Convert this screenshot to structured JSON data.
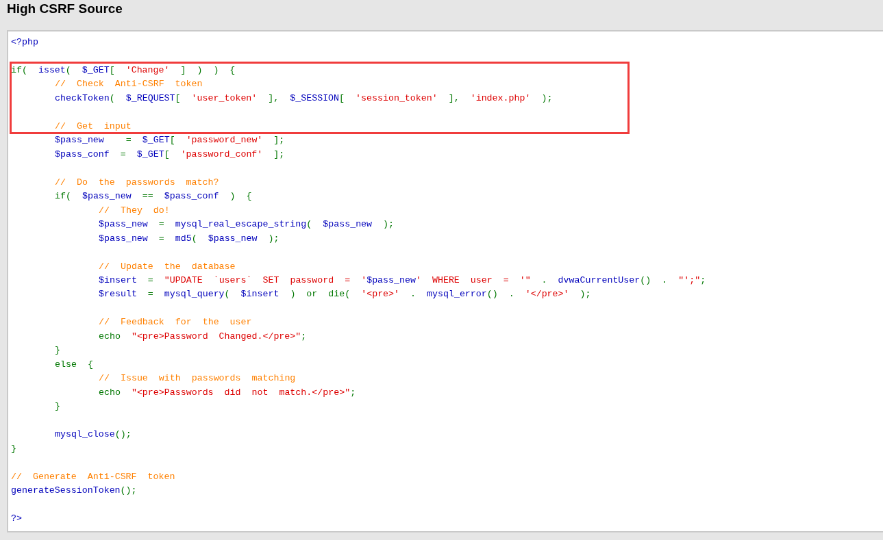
{
  "title": "High CSRF Source",
  "blocks": [
    {
      "highlighted": false,
      "lines": [
        {
          "kind": "code",
          "tokens": [
            {
              "kind": "default",
              "text": "<?php"
            }
          ]
        },
        {
          "kind": "blank"
        }
      ]
    },
    {
      "highlighted": true,
      "lines": [
        {
          "kind": "code",
          "tokens": [
            {
              "kind": "keyword",
              "text": "if( "
            },
            {
              "kind": "default",
              "text": "isset"
            },
            {
              "kind": "keyword",
              "text": "( "
            },
            {
              "kind": "default",
              "text": "$_GET"
            },
            {
              "kind": "keyword",
              "text": "[ "
            },
            {
              "kind": "string",
              "text": "'Change'"
            },
            {
              "kind": "keyword",
              "text": " ] ) ) {"
            }
          ]
        },
        {
          "kind": "code",
          "tokens": [
            {
              "kind": "comment",
              "text": "\t// Check Anti-CSRF token"
            }
          ]
        },
        {
          "kind": "code",
          "tokens": [
            {
              "kind": "default",
              "text": "\tcheckToken"
            },
            {
              "kind": "keyword",
              "text": "( "
            },
            {
              "kind": "default",
              "text": "$_REQUEST"
            },
            {
              "kind": "keyword",
              "text": "[ "
            },
            {
              "kind": "string",
              "text": "'user_token'"
            },
            {
              "kind": "keyword",
              "text": " ], "
            },
            {
              "kind": "default",
              "text": "$_SESSION"
            },
            {
              "kind": "keyword",
              "text": "[ "
            },
            {
              "kind": "string",
              "text": "'session_token'"
            },
            {
              "kind": "keyword",
              "text": " ], "
            },
            {
              "kind": "string",
              "text": "'index.php'"
            },
            {
              "kind": "keyword",
              "text": " );"
            }
          ]
        },
        {
          "kind": "blank"
        },
        {
          "kind": "code",
          "tokens": [
            {
              "kind": "comment",
              "text": "\t// Get input"
            }
          ]
        }
      ]
    },
    {
      "highlighted": false,
      "lines": [
        {
          "kind": "code",
          "tokens": [
            {
              "kind": "default",
              "text": "\t$pass_new "
            },
            {
              "kind": "keyword",
              "text": " = "
            },
            {
              "kind": "default",
              "text": "$_GET"
            },
            {
              "kind": "keyword",
              "text": "[ "
            },
            {
              "kind": "string",
              "text": "'password_new'"
            },
            {
              "kind": "keyword",
              "text": " ];"
            }
          ]
        },
        {
          "kind": "code",
          "tokens": [
            {
              "kind": "default",
              "text": "\t$pass_conf"
            },
            {
              "kind": "keyword",
              "text": " = "
            },
            {
              "kind": "default",
              "text": "$_GET"
            },
            {
              "kind": "keyword",
              "text": "[ "
            },
            {
              "kind": "string",
              "text": "'password_conf'"
            },
            {
              "kind": "keyword",
              "text": " ];"
            }
          ]
        },
        {
          "kind": "blank"
        },
        {
          "kind": "code",
          "tokens": [
            {
              "kind": "comment",
              "text": "\t// Do the passwords match?"
            }
          ]
        },
        {
          "kind": "code",
          "tokens": [
            {
              "kind": "keyword",
              "text": "\tif( "
            },
            {
              "kind": "default",
              "text": "$pass_new"
            },
            {
              "kind": "keyword",
              "text": " == "
            },
            {
              "kind": "default",
              "text": "$pass_conf"
            },
            {
              "kind": "keyword",
              "text": " ) {"
            }
          ]
        },
        {
          "kind": "code",
          "tokens": [
            {
              "kind": "comment",
              "text": "\t\t// They do!"
            }
          ]
        },
        {
          "kind": "code",
          "tokens": [
            {
              "kind": "default",
              "text": "\t\t$pass_new"
            },
            {
              "kind": "keyword",
              "text": " = "
            },
            {
              "kind": "default",
              "text": "mysql_real_escape_string"
            },
            {
              "kind": "keyword",
              "text": "( "
            },
            {
              "kind": "default",
              "text": "$pass_new"
            },
            {
              "kind": "keyword",
              "text": " );"
            }
          ]
        },
        {
          "kind": "code",
          "tokens": [
            {
              "kind": "default",
              "text": "\t\t$pass_new"
            },
            {
              "kind": "keyword",
              "text": " = "
            },
            {
              "kind": "default",
              "text": "md5"
            },
            {
              "kind": "keyword",
              "text": "( "
            },
            {
              "kind": "default",
              "text": "$pass_new"
            },
            {
              "kind": "keyword",
              "text": " );"
            }
          ]
        },
        {
          "kind": "blank"
        },
        {
          "kind": "code",
          "tokens": [
            {
              "kind": "comment",
              "text": "\t\t// Update the database"
            }
          ]
        },
        {
          "kind": "code",
          "tokens": [
            {
              "kind": "default",
              "text": "\t\t$insert"
            },
            {
              "kind": "keyword",
              "text": " = "
            },
            {
              "kind": "string",
              "text": "\"UPDATE `users` SET password = '"
            },
            {
              "kind": "default",
              "text": "$pass_new"
            },
            {
              "kind": "string",
              "text": "' WHERE user = '\""
            },
            {
              "kind": "keyword",
              "text": " . "
            },
            {
              "kind": "default",
              "text": "dvwaCurrentUser"
            },
            {
              "kind": "keyword",
              "text": "() . "
            },
            {
              "kind": "string",
              "text": "\"';\""
            },
            {
              "kind": "keyword",
              "text": ";"
            }
          ]
        },
        {
          "kind": "code",
          "tokens": [
            {
              "kind": "default",
              "text": "\t\t$result"
            },
            {
              "kind": "keyword",
              "text": " = "
            },
            {
              "kind": "default",
              "text": "mysql_query"
            },
            {
              "kind": "keyword",
              "text": "( "
            },
            {
              "kind": "default",
              "text": "$insert"
            },
            {
              "kind": "keyword",
              "text": " ) or die( "
            },
            {
              "kind": "string",
              "text": "'<pre>'"
            },
            {
              "kind": "keyword",
              "text": " . "
            },
            {
              "kind": "default",
              "text": "mysql_error"
            },
            {
              "kind": "keyword",
              "text": "() . "
            },
            {
              "kind": "string",
              "text": "'</pre>'"
            },
            {
              "kind": "keyword",
              "text": " );"
            }
          ]
        },
        {
          "kind": "blank"
        },
        {
          "kind": "code",
          "tokens": [
            {
              "kind": "comment",
              "text": "\t\t// Feedback for the user"
            }
          ]
        },
        {
          "kind": "code",
          "tokens": [
            {
              "kind": "keyword",
              "text": "\t\techo "
            },
            {
              "kind": "string",
              "text": "\"<pre>Password Changed.</pre>\""
            },
            {
              "kind": "keyword",
              "text": ";"
            }
          ]
        },
        {
          "kind": "code",
          "tokens": [
            {
              "kind": "keyword",
              "text": "\t}"
            }
          ]
        },
        {
          "kind": "code",
          "tokens": [
            {
              "kind": "keyword",
              "text": "\telse {"
            }
          ]
        },
        {
          "kind": "code",
          "tokens": [
            {
              "kind": "comment",
              "text": "\t\t// Issue with passwords matching"
            }
          ]
        },
        {
          "kind": "code",
          "tokens": [
            {
              "kind": "keyword",
              "text": "\t\techo "
            },
            {
              "kind": "string",
              "text": "\"<pre>Passwords did not match.</pre>\""
            },
            {
              "kind": "keyword",
              "text": ";"
            }
          ]
        },
        {
          "kind": "code",
          "tokens": [
            {
              "kind": "keyword",
              "text": "\t}"
            }
          ]
        },
        {
          "kind": "blank"
        },
        {
          "kind": "code",
          "tokens": [
            {
              "kind": "default",
              "text": "\tmysql_close"
            },
            {
              "kind": "keyword",
              "text": "();"
            }
          ]
        },
        {
          "kind": "code",
          "tokens": [
            {
              "kind": "keyword",
              "text": "}"
            }
          ]
        },
        {
          "kind": "blank"
        },
        {
          "kind": "code",
          "tokens": [
            {
              "kind": "comment",
              "text": "// Generate Anti-CSRF token"
            }
          ]
        },
        {
          "kind": "code",
          "tokens": [
            {
              "kind": "default",
              "text": "generateSessionToken"
            },
            {
              "kind": "keyword",
              "text": "();"
            }
          ]
        },
        {
          "kind": "blank"
        },
        {
          "kind": "code",
          "tokens": [
            {
              "kind": "default",
              "text": "?>"
            }
          ]
        }
      ]
    }
  ]
}
